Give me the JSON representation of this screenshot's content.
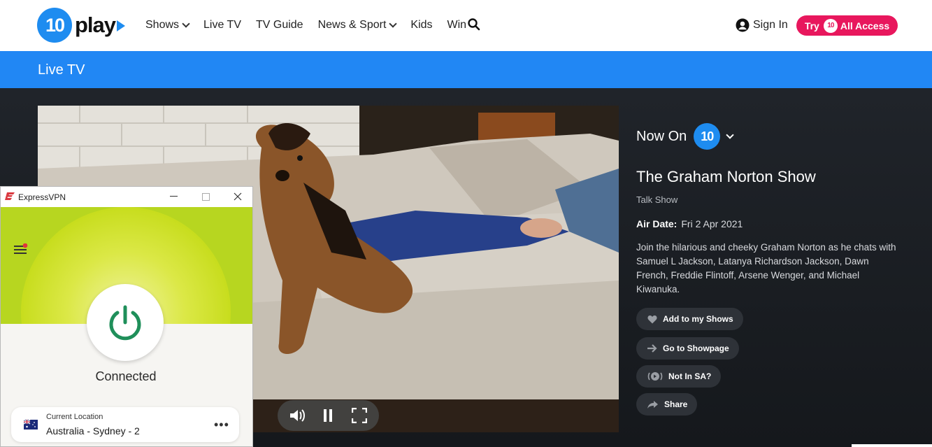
{
  "header": {
    "logo_mark": "10",
    "logo_word": "play",
    "nav": [
      {
        "label": "Shows",
        "dropdown": true
      },
      {
        "label": "Live TV",
        "dropdown": false
      },
      {
        "label": "TV Guide",
        "dropdown": false
      },
      {
        "label": "News & Sport",
        "dropdown": true
      },
      {
        "label": "Kids",
        "dropdown": false
      },
      {
        "label": "Win",
        "dropdown": false
      }
    ],
    "sign_in": "Sign In",
    "try_label": "Try",
    "try_badge": "10",
    "all_access": "All Access"
  },
  "band": {
    "title": "Live TV"
  },
  "player": {
    "controls": [
      "volume-icon",
      "pause-icon",
      "fullscreen-icon"
    ]
  },
  "now_on": {
    "label": "Now On",
    "channel_mark": "10",
    "title": "The Graham Norton Show",
    "genre": "Talk Show",
    "air_date_label": "Air Date:",
    "air_date": "Fri 2 Apr 2021",
    "description": "Join the hilarious and cheeky Graham Norton as he chats with Samuel L Jackson, Latanya Richardson Jackson, Dawn French, Freddie Flintoff, Arsene Wenger, and Michael Kiwanuka.",
    "actions": [
      {
        "label": "Add to my Shows",
        "icon": "heart-icon"
      },
      {
        "label": "Go to Showpage",
        "icon": "arrow-right-icon"
      },
      {
        "label": "Not In SA?",
        "icon": "broadcast-icon"
      },
      {
        "label": "Share",
        "icon": "share-icon"
      }
    ]
  },
  "vpn": {
    "title": "ExpressVPN",
    "status": "Connected",
    "location_label": "Current Location",
    "location_value": "Australia - Sydney - 2",
    "more": "•••"
  },
  "colors": {
    "brand_blue": "#2187f4",
    "access_pink": "#e8175d",
    "vpn_green": "#b7d620",
    "vpn_power": "#1f8f5a"
  }
}
